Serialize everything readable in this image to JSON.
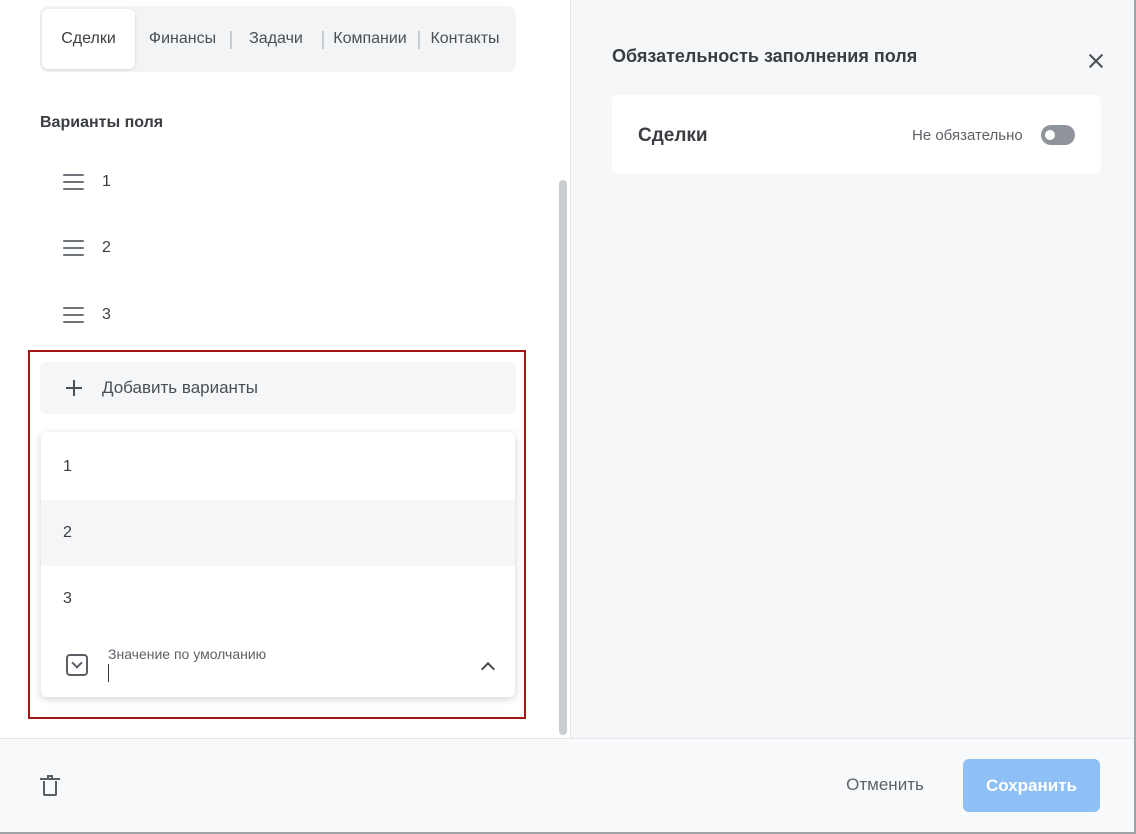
{
  "tabs": [
    {
      "label": "Сделки",
      "active": true
    },
    {
      "label": "Финансы",
      "active": false
    },
    {
      "label": "Задачи",
      "active": false
    },
    {
      "label": "Компании",
      "active": false
    },
    {
      "label": "Контакты",
      "active": false
    }
  ],
  "field_variants": {
    "title": "Варианты поля",
    "items": [
      {
        "label": "1"
      },
      {
        "label": "2"
      },
      {
        "label": "3"
      }
    ],
    "add_label": "Добавить варианты"
  },
  "default_value_dropdown": {
    "options": [
      {
        "label": "1"
      },
      {
        "label": "2"
      },
      {
        "label": "3"
      }
    ],
    "hovered_index": 1,
    "label": "Значение по умолчанию",
    "value": ""
  },
  "required_panel": {
    "title": "Обязательность заполнения поля",
    "entity_name": "Сделки",
    "toggle_label": "Не обязательно",
    "toggle_on": false
  },
  "footer": {
    "cancel_label": "Отменить",
    "save_label": "Сохранить"
  },
  "colors": {
    "highlight_border": "#a41515",
    "save_button": "#8ec0f5",
    "toggle_off": "#8e949a"
  },
  "icons": {
    "drag_handle": "hamburger-icon",
    "add": "plus-icon",
    "select": "dropdown-box-icon",
    "collapse": "chevron-up-icon",
    "close": "close-icon",
    "delete": "trash-icon"
  }
}
